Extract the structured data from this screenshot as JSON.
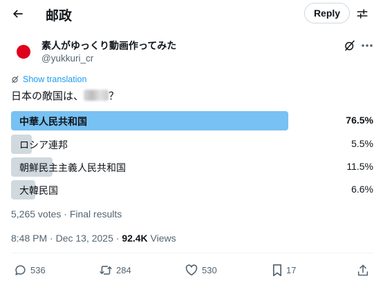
{
  "header": {
    "title": "邮政",
    "reply_label": "Reply"
  },
  "author": {
    "display_name": "素人がゆっくり動画作ってみた",
    "handle": "@yukkuri_cr",
    "avatar_color": "#e0001b"
  },
  "tweet": {
    "translate_label": "Show translation",
    "text_before": "日本の敵国は、",
    "text_after": "？"
  },
  "poll": {
    "options": [
      {
        "label": "中華人民共和国",
        "percent": "76.5%",
        "fraction": 0.765,
        "winner": true
      },
      {
        "label": "ロシア連邦",
        "percent": "5.5%",
        "fraction": 0.055,
        "winner": false
      },
      {
        "label": "朝鮮民主主義人民共和国",
        "percent": "11.5%",
        "fraction": 0.115,
        "winner": false
      },
      {
        "label": "大韓民国",
        "percent": "6.6%",
        "fraction": 0.066,
        "winner": false
      }
    ],
    "summary": "5,265 votes · Final results",
    "winner_color": "#78c1f3",
    "other_color": "#cfd9de"
  },
  "meta": {
    "time": "8:48 PM · Dec 13, 2025 · ",
    "views_count": "92.4K",
    "views_label": " Views"
  },
  "actions": {
    "replies": "536",
    "reposts": "284",
    "likes": "530",
    "bookmarks": "17"
  },
  "icons": [
    "back-arrow-icon",
    "adjust-icon",
    "grok-icon",
    "more-icon",
    "translate-icon",
    "reply-icon",
    "repost-icon",
    "like-icon",
    "bookmark-icon",
    "share-icon"
  ]
}
